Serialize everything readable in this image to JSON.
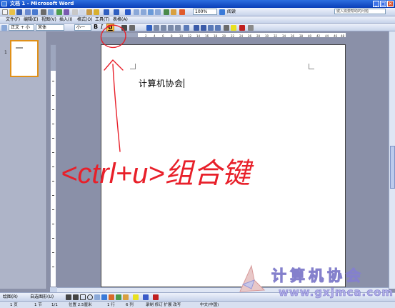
{
  "window": {
    "title": "文档 1 - Microsoft Word"
  },
  "toolbar": {
    "zoom": "100%",
    "read_label": "阅读",
    "help_placeholder": "键入需要帮助的问题"
  },
  "menubar": {
    "items": [
      "文件(F)",
      "编辑(E)",
      "视图(V)",
      "插入(I)",
      "格式(O)",
      "工具(T)",
      "表格(A)"
    ]
  },
  "format_toolbar": {
    "style": "正文 + 小一",
    "font": "宋体",
    "size": "小一",
    "bold": "B",
    "italic": "I",
    "underline": "U"
  },
  "thumbnail": {
    "page_label": "1"
  },
  "ruler": {
    "ticks": [
      "2",
      "4",
      "6",
      "8",
      "10",
      "12",
      "14",
      "16",
      "18",
      "20",
      "22",
      "24",
      "26",
      "28",
      "30",
      "32",
      "34",
      "36",
      "38",
      "40",
      "42",
      "44",
      "46",
      "48"
    ]
  },
  "document": {
    "text": "计算机协会"
  },
  "draw_toolbar": {
    "draw_label": "绘图(R)",
    "autoshape_label": "自选图形(U)"
  },
  "status": {
    "page": "1 页",
    "section": "1 节",
    "page_of": "1/1",
    "position": "位置 2.5厘米",
    "line": "1 行",
    "column": "6 列",
    "modes": "录制 修订 扩展 改写",
    "language": "中文(中国)"
  },
  "annotation": {
    "text": "<ctrl+u>组合键"
  },
  "watermark": {
    "title": "计算机协会",
    "url": "www.gxjmca.com"
  },
  "colors": {
    "annotation": "#e8202a",
    "watermark": "#b0aee8",
    "titlebar": "#0a3fb8"
  }
}
